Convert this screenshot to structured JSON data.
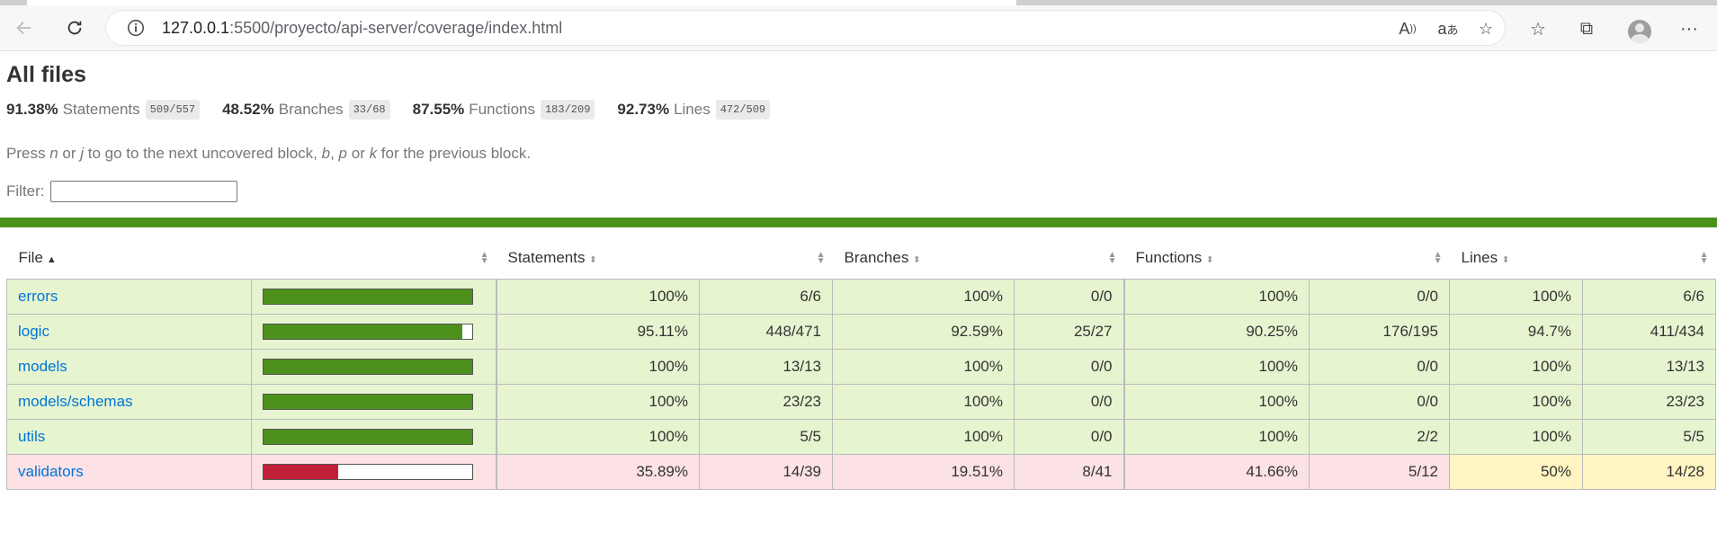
{
  "browser": {
    "url_host": "127.0.0.1",
    "url_path": ":5500/proyecto/api-server/coverage/index.html"
  },
  "page": {
    "title": "All files",
    "summary": [
      {
        "pct": "91.38%",
        "label": "Statements",
        "fraction": "509/557"
      },
      {
        "pct": "48.52%",
        "label": "Branches",
        "fraction": "33/68"
      },
      {
        "pct": "87.55%",
        "label": "Functions",
        "fraction": "183/209"
      },
      {
        "pct": "92.73%",
        "label": "Lines",
        "fraction": "472/509"
      }
    ],
    "hint": {
      "t1": "Press ",
      "n": "n",
      "t2": " or ",
      "j": "j",
      "t3": " to go to the next uncovered block, ",
      "b": "b",
      "t4": ", ",
      "p": "p",
      "t5": " or ",
      "k": "k",
      "t6": " for the previous block."
    },
    "filter_label": "Filter:",
    "filter_value": ""
  },
  "table": {
    "headers": {
      "file": "File",
      "statements": "Statements",
      "branches": "Branches",
      "functions": "Functions",
      "lines": "Lines"
    },
    "rows": [
      {
        "file": "errors",
        "coverage": 1.0,
        "st_pct": "100%",
        "st_frac": "6/6",
        "br_pct": "100%",
        "br_frac": "0/0",
        "fn_pct": "100%",
        "fn_frac": "0/0",
        "ln_pct": "100%",
        "ln_frac": "6/6"
      },
      {
        "file": "logic",
        "coverage": 0.9511,
        "st_pct": "95.11%",
        "st_frac": "448/471",
        "br_pct": "92.59%",
        "br_frac": "25/27",
        "fn_pct": "90.25%",
        "fn_frac": "176/195",
        "ln_pct": "94.7%",
        "ln_frac": "411/434"
      },
      {
        "file": "models",
        "coverage": 1.0,
        "st_pct": "100%",
        "st_frac": "13/13",
        "br_pct": "100%",
        "br_frac": "0/0",
        "fn_pct": "100%",
        "fn_frac": "0/0",
        "ln_pct": "100%",
        "ln_frac": "13/13"
      },
      {
        "file": "models/schemas",
        "coverage": 1.0,
        "st_pct": "100%",
        "st_frac": "23/23",
        "br_pct": "100%",
        "br_frac": "0/0",
        "fn_pct": "100%",
        "fn_frac": "0/0",
        "ln_pct": "100%",
        "ln_frac": "23/23"
      },
      {
        "file": "utils",
        "coverage": 1.0,
        "st_pct": "100%",
        "st_frac": "5/5",
        "br_pct": "100%",
        "br_frac": "0/0",
        "fn_pct": "100%",
        "fn_frac": "2/2",
        "ln_pct": "100%",
        "ln_frac": "5/5"
      },
      {
        "file": "validators",
        "coverage": 0.3589,
        "st_pct": "35.89%",
        "st_frac": "14/39",
        "br_pct": "19.51%",
        "br_frac": "8/41",
        "fn_pct": "41.66%",
        "fn_frac": "5/12",
        "ln_pct": "50%",
        "ln_frac": "14/28"
      }
    ]
  }
}
